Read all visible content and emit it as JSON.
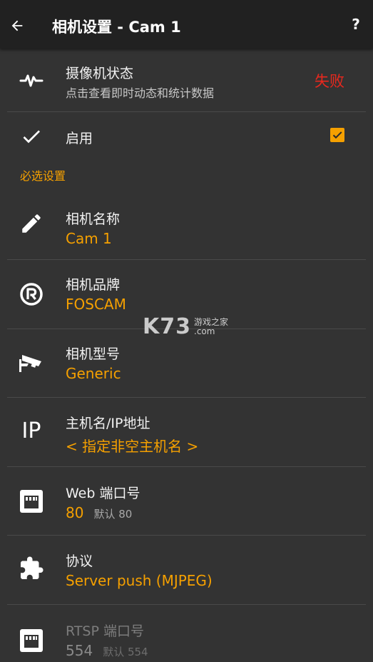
{
  "app_bar": {
    "title": "相机设置 - Cam 1",
    "help_label": "?",
    "back_icon": "arrow-left-icon"
  },
  "status_row": {
    "title": "摄像机状态",
    "subtitle": "点击查看即时动态和统计数据",
    "status": "失败",
    "status_color": "#e8281e",
    "icon": "activity-pulse-icon"
  },
  "enable_row": {
    "title": "启用",
    "checked": true,
    "icon": "check-icon"
  },
  "section": {
    "required_header": "必选设置"
  },
  "settings": [
    {
      "key": "camera_name",
      "title": "相机名称",
      "value": "Cam 1",
      "icon": "pencil-icon"
    },
    {
      "key": "camera_brand",
      "title": "相机品牌",
      "value": "FOSCAM",
      "icon": "registered-trademark-icon"
    },
    {
      "key": "camera_model",
      "title": "相机型号",
      "value": "Generic",
      "icon": "security-camera-icon"
    },
    {
      "key": "hostname",
      "title": "主机名/IP地址",
      "value": "< 指定非空主机名 >",
      "icon": "ip-icon",
      "icon_text": "IP"
    },
    {
      "key": "web_port",
      "title": "Web 端口号",
      "value": "80",
      "hint": "默认 80",
      "icon": "ethernet-port-icon"
    },
    {
      "key": "protocol",
      "title": "协议",
      "value": "Server push (MJPEG)",
      "icon": "puzzle-piece-icon"
    },
    {
      "key": "rtsp_port",
      "title": "RTSP 端口号",
      "value": "554",
      "hint": "默认 554",
      "icon": "ethernet-port-icon",
      "disabled": true
    }
  ],
  "watermark": {
    "logo": "K73",
    "line1": "游戏之家",
    "line2": ".com"
  },
  "colors": {
    "accent": "#f5a000",
    "background": "#333333",
    "app_bar": "#212121"
  }
}
